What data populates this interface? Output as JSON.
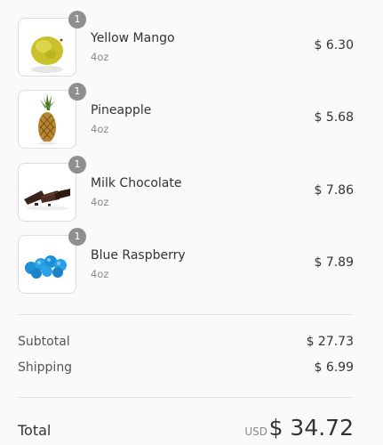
{
  "items": [
    {
      "name": "Yellow Mango",
      "variant": "4oz",
      "price": "$ 6.30",
      "quantity": "1",
      "image": "yellow-mango"
    },
    {
      "name": "Pineapple",
      "variant": "4oz",
      "price": "$ 5.68",
      "quantity": "1",
      "image": "pineapple"
    },
    {
      "name": "Milk Chocolate",
      "variant": "4oz",
      "price": "$ 7.86",
      "quantity": "1",
      "image": "milk-chocolate"
    },
    {
      "name": "Blue Raspberry",
      "variant": "4oz",
      "price": "$ 7.89",
      "quantity": "1",
      "image": "blue-raspberry"
    }
  ],
  "summary": {
    "subtotal_label": "Subtotal",
    "subtotal_value": "$ 27.73",
    "shipping_label": "Shipping",
    "shipping_value": "$ 6.99"
  },
  "total": {
    "label": "Total",
    "currency": "USD",
    "value": "$ 34.72"
  },
  "colors": {
    "badge": "#8f8f8f",
    "text": "#333333",
    "muted": "#8a8a8a",
    "divider": "#e1e1e1",
    "background": "#fafafa"
  }
}
